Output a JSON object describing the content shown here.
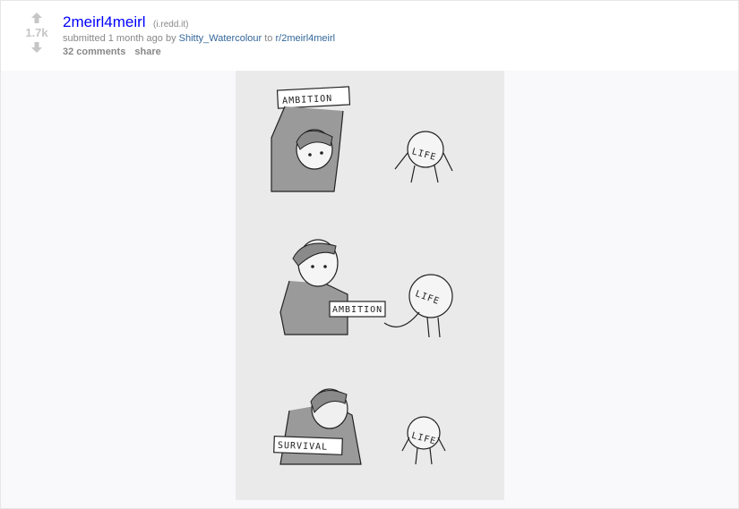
{
  "post": {
    "score": "1.7k",
    "title": "2meirl4meirl",
    "domain": "(i.redd.it)",
    "submitted_prefix": "submitted 1 month ago by",
    "author": "Shitty_Watercolour",
    "to_word": "to",
    "subreddit": "r/2meirl4meirl",
    "comments": "32 comments",
    "share": "share"
  },
  "comic": {
    "panel1_sign": "AMBITION",
    "panel1_life": "LIFE",
    "panel2_sign": "AMBITION",
    "panel2_life": "LIFE",
    "panel3_sign": "SURVIVAL",
    "panel3_life": "LIFE"
  },
  "colors": {
    "title_link": "#0000ff",
    "tag_link": "#336699",
    "muted": "#888888"
  }
}
